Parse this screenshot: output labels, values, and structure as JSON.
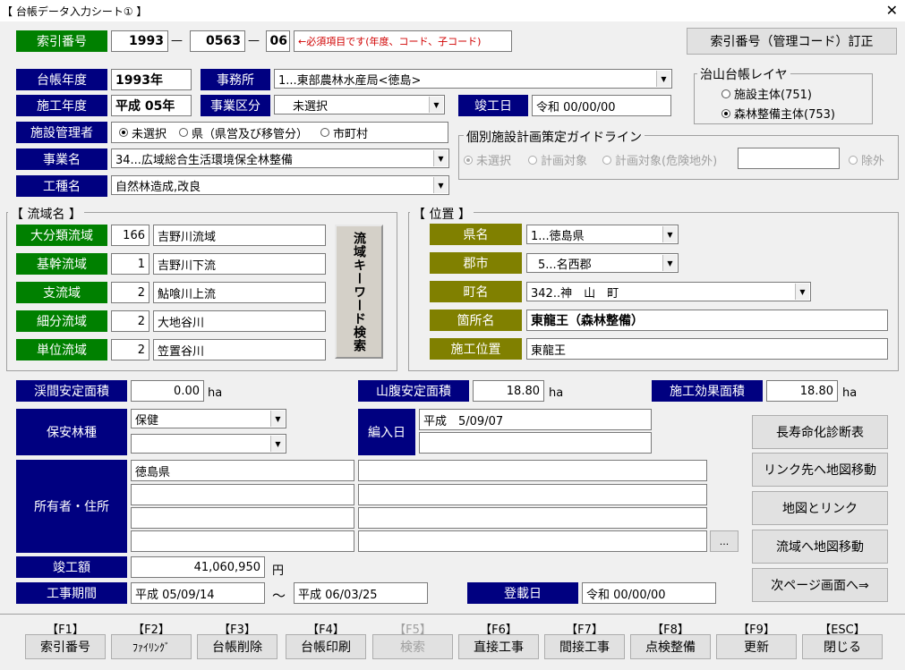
{
  "window": {
    "title": "【 台帳データ入力シート① 】",
    "close_glyph": "✕"
  },
  "index": {
    "label": "索引番号",
    "year": "1993",
    "code": "0563",
    "sub": "06",
    "dash": "—",
    "note": "←必須項目です(年度、コード、子コード)",
    "fix_button": "索引番号（管理コード）訂正"
  },
  "ledger": {
    "year_label": "台帳年度",
    "year_value": "1993年",
    "office_label": "事務所",
    "office_value": "1...東部農林水産局<徳島>",
    "work_year_label": "施工年度",
    "work_year_value": "平成 05年",
    "category_label": "事業区分",
    "category_value": "未選択",
    "completion_label": "竣工日",
    "completion_value": "令和 00/00/00",
    "manager_label": "施設管理者",
    "manager_options": [
      "未選択",
      "県（県営及び移管分）",
      "市町村"
    ],
    "project_label": "事業名",
    "project_value": "34...広域総合生活環境保全林整備",
    "worktype_label": "工種名",
    "worktype_value": "自然林造成,改良"
  },
  "layer": {
    "title": "治山台帳レイヤ",
    "options": [
      "施設主体(751)",
      "森林整備主体(753)"
    ]
  },
  "guideline": {
    "title": "個別施設計画策定ガイドライン",
    "options": [
      "未選択",
      "計画対象",
      "計画対象(危険地外)"
    ],
    "exclude": "除外",
    "input": ""
  },
  "basin": {
    "title": "【 流域名 】",
    "rows": [
      {
        "label": "大分類流域",
        "code": "166",
        "name": "吉野川流域"
      },
      {
        "label": "基幹流域",
        "code": "1",
        "name": "吉野川下流"
      },
      {
        "label": "支流域",
        "code": "2",
        "name": "鮎喰川上流"
      },
      {
        "label": "細分流域",
        "code": "2",
        "name": "大地谷川"
      },
      {
        "label": "単位流域",
        "code": "2",
        "name": "笠置谷川"
      }
    ],
    "keyword_button": "流域キーワード検索"
  },
  "location": {
    "title": "【 位置 】",
    "pref_label": "県名",
    "pref_value": "1...徳島県",
    "city_label": "郡市",
    "city_value": "5...名西郡",
    "town_label": "町名",
    "town_value": "342..神　山　町",
    "place_label": "箇所名",
    "place_value": "東龍王（森林整備）",
    "site_label": "施工位置",
    "site_value": "東龍王"
  },
  "areas": {
    "valley_label": "渓間安定面積",
    "valley_value": "0.00",
    "slope_label": "山腹安定面積",
    "slope_value": "18.80",
    "effect_label": "施工効果面積",
    "effect_value": "18.80",
    "unit": "ha"
  },
  "forest": {
    "label": "保安林種",
    "value1": "保健",
    "value2": ""
  },
  "entry": {
    "label": "編入日",
    "value1": "平成　5/09/07",
    "value2": ""
  },
  "owner": {
    "label": "所有者・住所",
    "names": [
      "徳島県",
      "",
      "",
      ""
    ],
    "addresses": [
      "",
      "",
      "",
      ""
    ],
    "more_button": "..."
  },
  "cost": {
    "label": "竣工額",
    "value": "41,060,950",
    "unit": "円"
  },
  "period": {
    "label": "工事期間",
    "from": "平成 05/09/14",
    "tilde": "～",
    "to": "平成 06/03/25"
  },
  "registered": {
    "label": "登載日",
    "value": "令和 00/00/00"
  },
  "side_buttons": [
    "長寿命化診断表",
    "リンク先へ地図移動",
    "地図とリンク",
    "流域へ地図移動",
    "次ページ画面へ⇒"
  ],
  "fkeys": [
    {
      "key": "【F1】",
      "label": "索引番号",
      "enabled": true
    },
    {
      "key": "【F2】",
      "label": "ﾌｧｲﾘﾝｸﾞ",
      "enabled": true
    },
    {
      "key": "【F3】",
      "label": "台帳削除",
      "enabled": true
    },
    {
      "key": "【F4】",
      "label": "台帳印刷",
      "enabled": true
    },
    {
      "key": "【F5】",
      "label": "検索",
      "enabled": false
    },
    {
      "key": "【F6】",
      "label": "直接工事",
      "enabled": true
    },
    {
      "key": "【F7】",
      "label": "間接工事",
      "enabled": true
    },
    {
      "key": "【F8】",
      "label": "点検整備",
      "enabled": true
    },
    {
      "key": "【F9】",
      "label": "更新",
      "enabled": true
    },
    {
      "key": "【ESC】",
      "label": "閉じる",
      "enabled": true
    }
  ]
}
